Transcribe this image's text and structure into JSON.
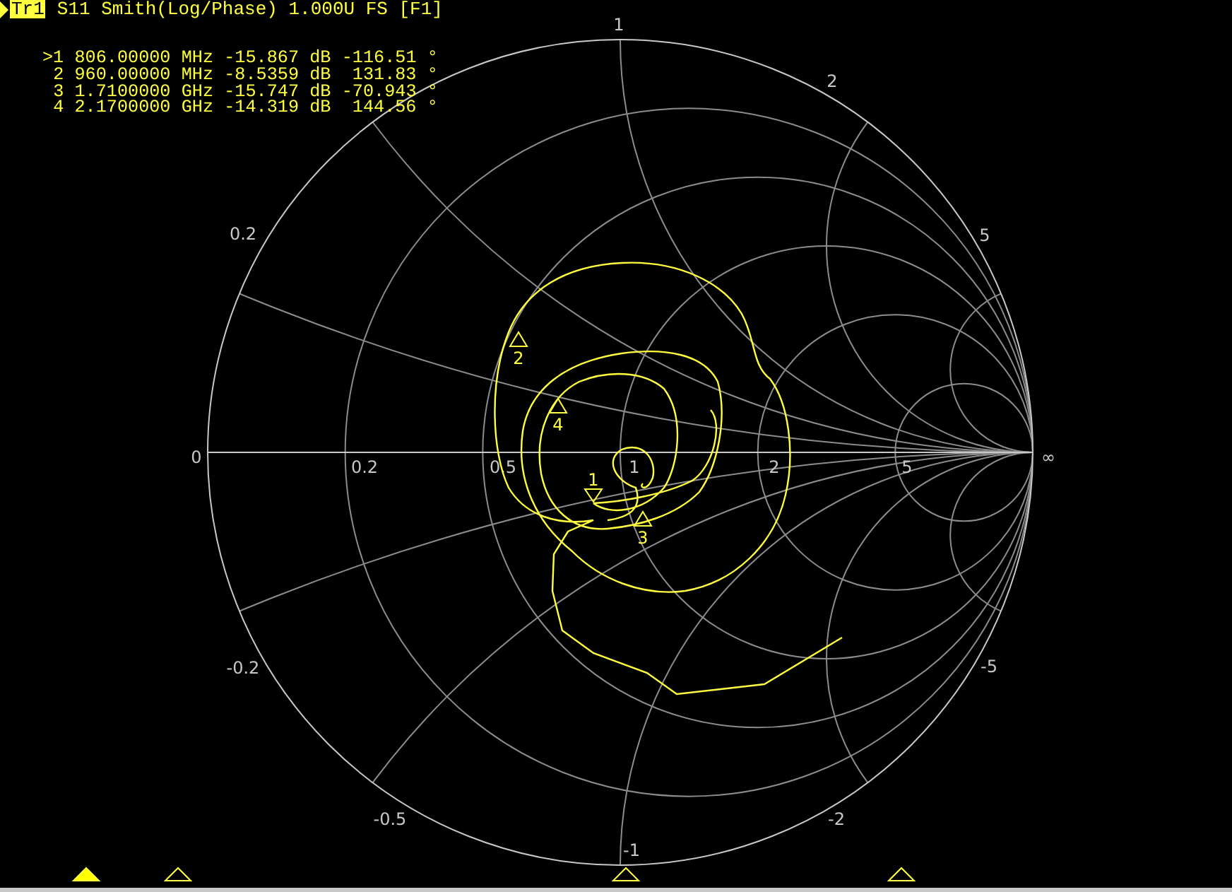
{
  "header": {
    "trace_tag": "Tr1",
    "title": "S11 Smith(Log/Phase) 1.000U FS [F1]"
  },
  "markers": [
    {
      "label": ">1",
      "frequency": "806.00000",
      "freq_unit": "MHz",
      "magnitude": "-15.867",
      "mag_unit": "dB",
      "phase": "-116.51",
      "phase_unit": "°",
      "chart_label": "1",
      "selected": true
    },
    {
      "label": "2",
      "frequency": "960.00000",
      "freq_unit": "MHz",
      "magnitude": "-8.5359",
      "mag_unit": "dB",
      "phase": "131.83",
      "phase_unit": "°",
      "chart_label": "2",
      "selected": false
    },
    {
      "label": "3",
      "frequency": "1.7100000",
      "freq_unit": "GHz",
      "magnitude": "-15.747",
      "mag_unit": "dB",
      "phase": "-70.943",
      "phase_unit": "°",
      "chart_label": "3",
      "selected": false
    },
    {
      "label": "4",
      "frequency": "2.1700000",
      "freq_unit": "GHz",
      "magnitude": "-14.319",
      "mag_unit": "dB",
      "phase": "144.56",
      "phase_unit": "°",
      "chart_label": "4",
      "selected": false
    }
  ],
  "chart": {
    "resistance_labels": [
      "0",
      "0.2",
      "0.5",
      "1",
      "2",
      "5",
      "∞"
    ],
    "reactance_labels": [
      "1",
      "2",
      "5",
      "0.2",
      "-0.2",
      "-5",
      "-0.5",
      "-1",
      "-2"
    ]
  }
}
